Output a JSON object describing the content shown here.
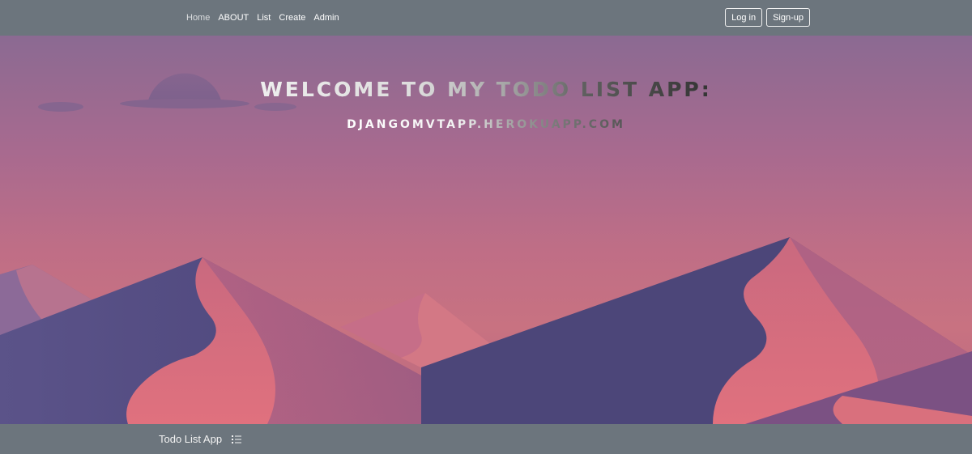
{
  "navbar": {
    "links": [
      {
        "label": "Home"
      },
      {
        "label": "ABOUT"
      },
      {
        "label": "List"
      },
      {
        "label": "Create"
      },
      {
        "label": "Admin"
      }
    ],
    "login_label": "Log in",
    "signup_label": "Sign-up"
  },
  "hero": {
    "title": "WELCOME TO MY TODO LIST APP:",
    "subtitle": "DJANGOMVTAPP.HEROKUAPP.COM",
    "background_icon": "desert-dunes-illustration"
  },
  "footer": {
    "brand": "Todo List App",
    "brand_icon": "list-icon"
  },
  "colors": {
    "bar": "#6c757d",
    "sky_top": "#8b6a92",
    "sky_bottom": "#c87281",
    "dune_dark": "#4f4a7e",
    "dune_light": "#d56d7e"
  }
}
